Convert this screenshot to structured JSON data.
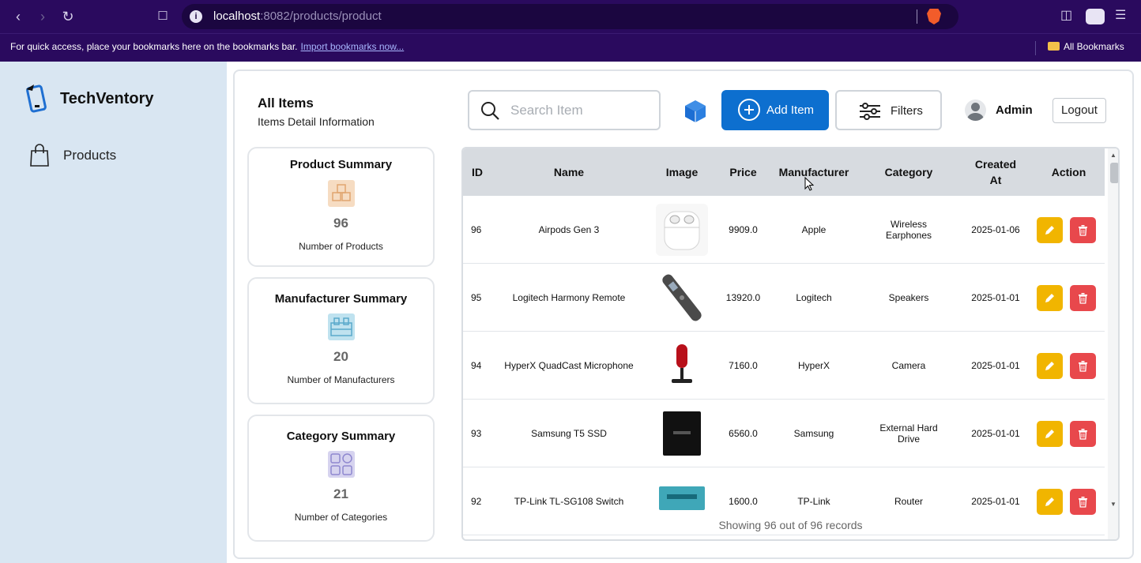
{
  "browser": {
    "url_host": "localhost",
    "url_path": ":8082/products/product",
    "bookmarks_message": "For quick access, place your bookmarks here on the bookmarks bar.",
    "bookmarks_link": "Import bookmarks now...",
    "all_bookmarks": "All Bookmarks"
  },
  "sidebar": {
    "brand": "TechVentory",
    "items": [
      {
        "label": "Products"
      }
    ]
  },
  "header": {
    "title": "All Items",
    "subtitle": "Items Detail Information",
    "search_placeholder": "Search Item",
    "add_label": "Add Item",
    "filters_label": "Filters",
    "user": "Admin",
    "logout_label": "Logout"
  },
  "summaries": [
    {
      "title": "Product Summary",
      "value": "96",
      "caption": "Number of Products",
      "icon": "boxes-icon",
      "color": "#f6dcc2"
    },
    {
      "title": "Manufacturer Summary",
      "value": "20",
      "caption": "Number of Manufacturers",
      "icon": "factory-icon",
      "color": "#bfe2ef"
    },
    {
      "title": "Category Summary",
      "value": "21",
      "caption": "Number of Categories",
      "icon": "grid-icon",
      "color": "#d6d3ef"
    }
  ],
  "table": {
    "columns": [
      "ID",
      "Name",
      "Image",
      "Price",
      "Manufacturer",
      "Category",
      "Created At",
      "Action"
    ],
    "rows": [
      {
        "id": "96",
        "name": "Airpods Gen 3",
        "image": "airpods",
        "price": "9909.0",
        "manufacturer": "Apple",
        "category": "Wireless Earphones",
        "created": "2025-01-06"
      },
      {
        "id": "95",
        "name": "Logitech Harmony Remote",
        "image": "remote",
        "price": "13920.0",
        "manufacturer": "Logitech",
        "category": "Speakers",
        "created": "2025-01-01"
      },
      {
        "id": "94",
        "name": "HyperX QuadCast Microphone",
        "image": "microphone",
        "price": "7160.0",
        "manufacturer": "HyperX",
        "category": "Camera",
        "created": "2025-01-01"
      },
      {
        "id": "93",
        "name": "Samsung T5 SSD",
        "image": "ssd",
        "price": "6560.0",
        "manufacturer": "Samsung",
        "category": "External Hard Drive",
        "created": "2025-01-01"
      },
      {
        "id": "92",
        "name": "TP-Link TL-SG108 Switch",
        "image": "switch",
        "price": "1600.0",
        "manufacturer": "TP-Link",
        "category": "Router",
        "created": "2025-01-01"
      }
    ],
    "footer": "Showing 96 out of 96 records"
  },
  "colors": {
    "accent": "#0d6fcf",
    "edit": "#f1b500",
    "delete": "#e8484c",
    "sidebar": "#d9e6f2",
    "chrome": "#2a0a5e"
  }
}
